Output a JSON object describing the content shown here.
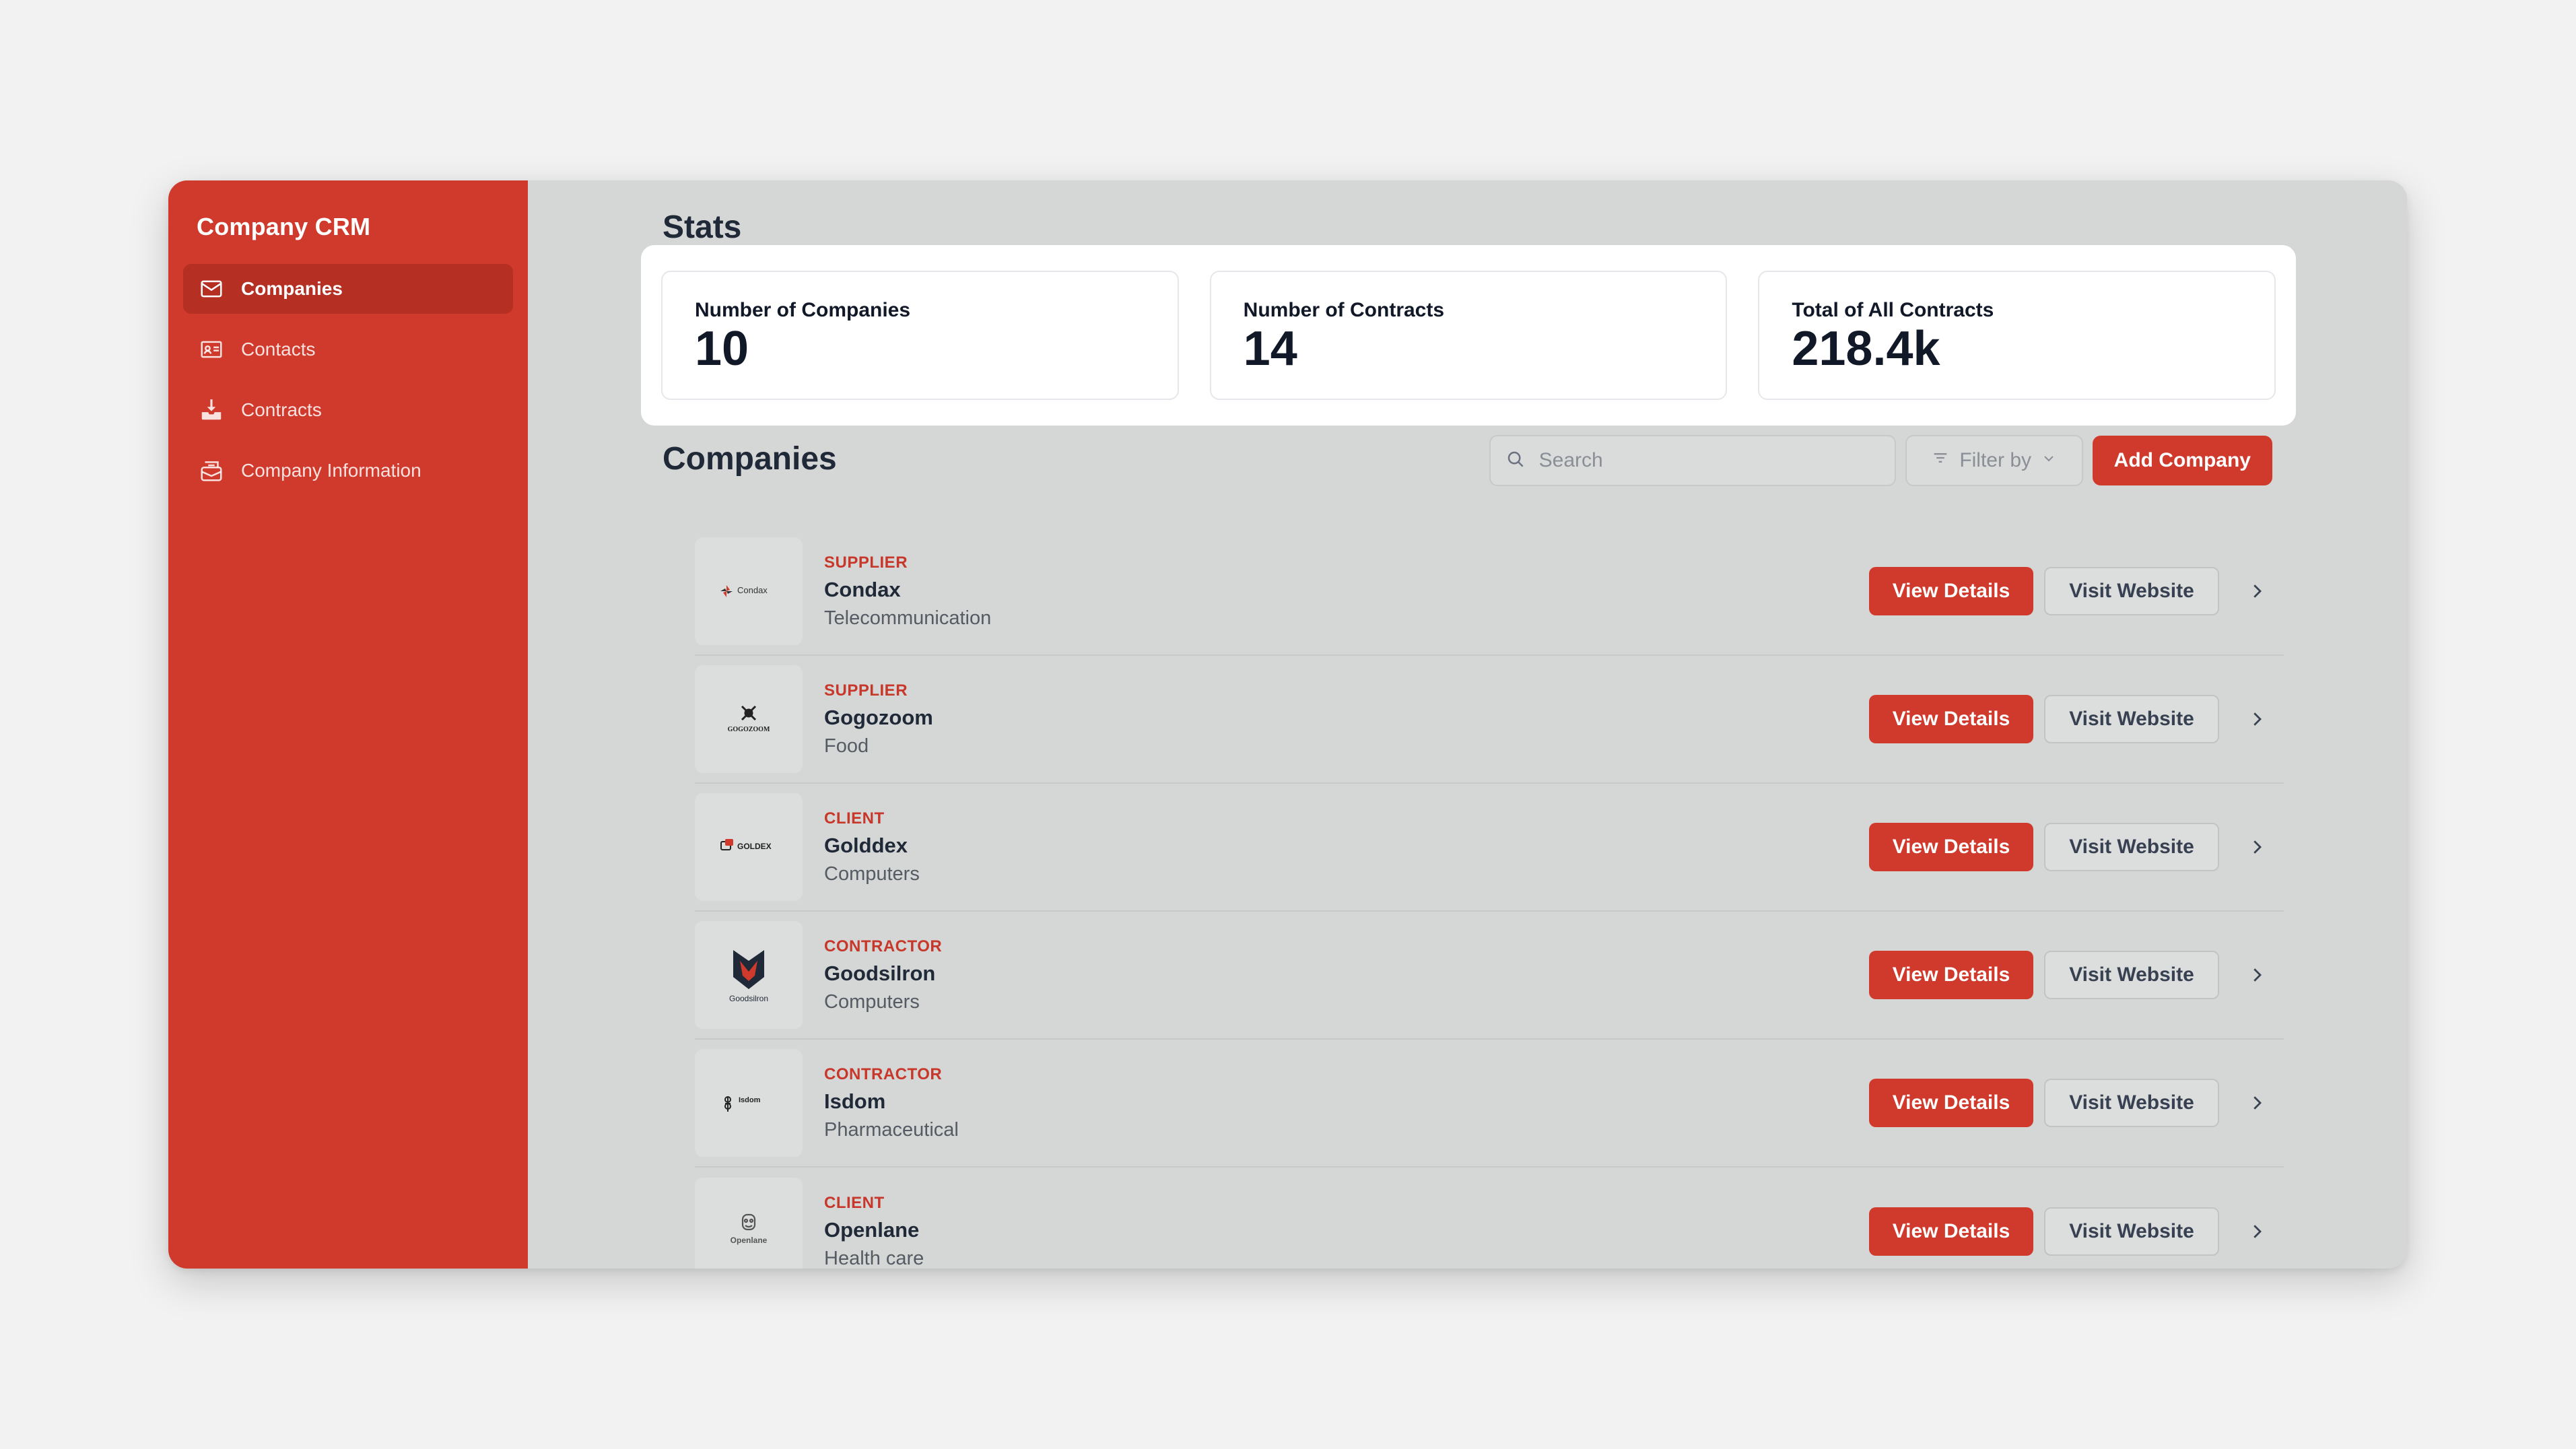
{
  "sidebar": {
    "brand": "Company CRM",
    "items": [
      {
        "label": "Companies",
        "icon": "mail-icon",
        "active": true
      },
      {
        "label": "Contacts",
        "icon": "id-card-icon",
        "active": false
      },
      {
        "label": "Contracts",
        "icon": "inbox-download-icon",
        "active": false
      },
      {
        "label": "Company Information",
        "icon": "info-box-icon",
        "active": false
      }
    ]
  },
  "stats": {
    "title": "Stats",
    "cards": [
      {
        "label": "Number of Companies",
        "value": "10"
      },
      {
        "label": "Number of Contracts",
        "value": "14"
      },
      {
        "label": "Total of All Contracts",
        "value": "218.4k"
      }
    ]
  },
  "companies": {
    "title": "Companies",
    "search_placeholder": "Search",
    "filter_label": "Filter by",
    "add_label": "Add Company",
    "view_label": "View Details",
    "visit_label": "Visit Website",
    "rows": [
      {
        "type": "SUPPLIER",
        "name": "Condax",
        "industry": "Telecommunication",
        "logo_text": "Condax"
      },
      {
        "type": "SUPPLIER",
        "name": "Gogozoom",
        "industry": "Food",
        "logo_text": "GOGOZOOM"
      },
      {
        "type": "CLIENT",
        "name": "Golddex",
        "industry": "Computers",
        "logo_text": "GOLDEX"
      },
      {
        "type": "CONTRACTOR",
        "name": "Goodsilron",
        "industry": "Computers",
        "logo_text": "Goodsilron"
      },
      {
        "type": "CONTRACTOR",
        "name": "Isdom",
        "industry": "Pharmaceutical",
        "logo_text": "Isdom"
      },
      {
        "type": "CLIENT",
        "name": "Openlane",
        "industry": "Health care",
        "logo_text": "Openlane"
      }
    ]
  },
  "colors": {
    "accent": "#d03a2c",
    "background": "#d5d6d6"
  }
}
